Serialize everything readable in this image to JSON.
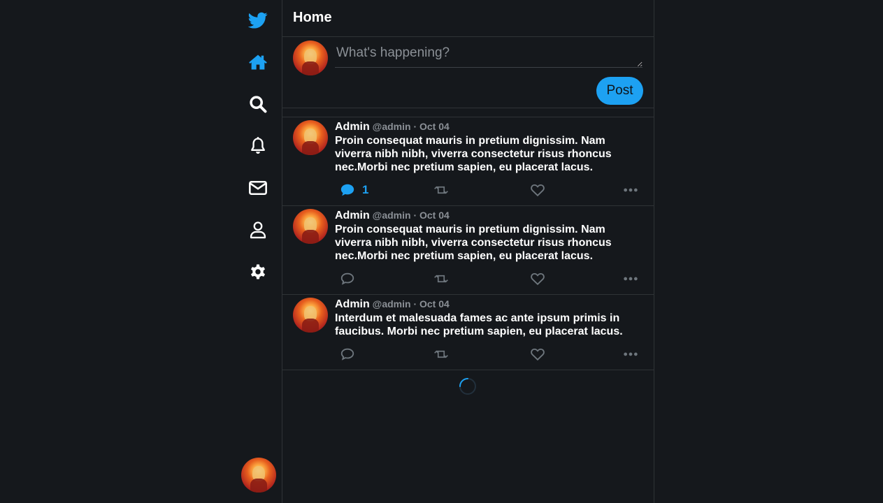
{
  "header": {
    "title": "Home"
  },
  "compose": {
    "placeholder": "What's happening?",
    "post_label": "Post"
  },
  "colors": {
    "accent": "#1da1f2",
    "background": "#15181c",
    "border": "#2f3336",
    "muted": "#8b9096"
  },
  "sidebar": {
    "items": [
      {
        "icon": "twitter-logo-icon"
      },
      {
        "icon": "home-icon"
      },
      {
        "icon": "search-icon"
      },
      {
        "icon": "bell-icon"
      },
      {
        "icon": "envelope-icon"
      },
      {
        "icon": "user-icon"
      },
      {
        "icon": "gear-icon"
      }
    ]
  },
  "tweets": [
    {
      "name": "Admin",
      "meta": "@admin · Oct 04",
      "text": "Proin consequat mauris in pretium dignissim. Nam viverra nibh nibh, viverra consectetur risus rhoncus nec.Morbi nec pretium sapien, eu placerat lacus.",
      "reply_count": "1"
    },
    {
      "name": "Admin",
      "meta": "@admin · Oct 04",
      "text": "Proin consequat mauris in pretium dignissim. Nam viverra nibh nibh, viverra consectetur risus rhoncus nec.Morbi nec pretium sapien, eu placerat lacus.",
      "reply_count": ""
    },
    {
      "name": "Admin",
      "meta": "@admin · Oct 04",
      "text": "Interdum et malesuada fames ac ante ipsum primis in faucibus. Morbi nec pretium sapien, eu placerat lacus.",
      "reply_count": ""
    }
  ]
}
